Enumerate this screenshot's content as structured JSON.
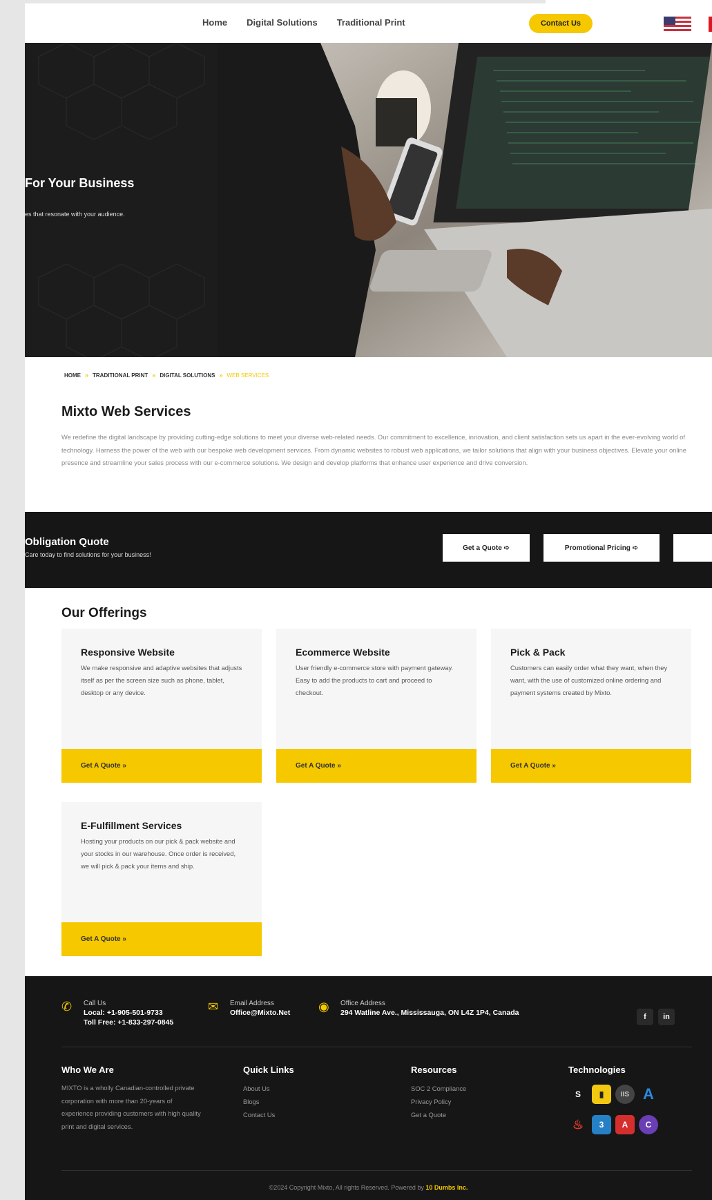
{
  "header": {
    "nav": [
      "Home",
      "Digital Solutions",
      "Traditional Print"
    ],
    "contact_button": "Contact Us"
  },
  "hero": {
    "title": "For Your Business",
    "subtitle": "es that resonate with your audience."
  },
  "breadcrumb": {
    "items": [
      "HOME",
      "TRADITIONAL PRINT",
      "DIGITAL SOLUTIONS"
    ],
    "current": "WEB SERVICES",
    "separator": "»"
  },
  "intro": {
    "title": "Mixto Web Services",
    "text": "We redefine the digital landscape by providing cutting-edge solutions to meet your diverse web-related needs. Our commitment to excellence, innovation, and client satisfaction sets us apart in the ever-evolving world of technology. Harness the power of the web with our bespoke web development services. From dynamic websites to robust web applications, we tailor solutions that align with your business objectives. Elevate your online presence and streamline your sales process with our e-commerce solutions. We design and develop platforms that enhance user experience and drive conversion."
  },
  "quote_band": {
    "title": "Obligation Quote",
    "subtitle": "Care today to find solutions for your business!",
    "buttons": [
      "Get a Quote ➪",
      "Promotional Pricing ➪"
    ]
  },
  "offerings": {
    "title": "Our Offerings",
    "cards": [
      {
        "title": "Responsive Website",
        "desc": "We make responsive and adaptive websites that adjusts itself as per the screen size such as phone, tablet, desktop or any device.",
        "button": "Get A Quote »"
      },
      {
        "title": "Ecommerce Website",
        "desc": "User friendly e-commerce store with payment gateway. Easy to add the products to cart and proceed to checkout.",
        "button": "Get A Quote »"
      },
      {
        "title": "Pick & Pack",
        "desc": "Customers can easily order what they want, when they want, with the use of customized online ordering and payment systems created by Mixto.",
        "button": "Get A Quote »"
      },
      {
        "title": "E-Fulfillment Services",
        "desc": "Hosting your products on our pick & pack website and your stocks in our warehouse. Once order is received, we will pick & pack your items and ship.",
        "button": "Get A Quote »"
      }
    ]
  },
  "footer": {
    "call": {
      "label": "Call Us",
      "local": "Local: +1-905-501-9733",
      "tollfree": "Toll Free: +1-833-297-0845"
    },
    "email": {
      "label": "Email Address",
      "value": "Office@Mixto.Net"
    },
    "office": {
      "label": "Office Address",
      "value": "294 Watline Ave., Mississauga, ON L4Z 1P4, Canada"
    },
    "who": {
      "title": "Who We Are",
      "text": "MIXTO is a wholly Canadian-controlled private corporation with more than 20-years of experience providing customers with high quality print and digital services."
    },
    "quick_links": {
      "title": "Quick Links",
      "items": [
        "About Us",
        "Blogs",
        "Contact Us"
      ]
    },
    "resources": {
      "title": "Resources",
      "items": [
        "SOC 2 Compliance",
        "Privacy Policy",
        "Get a Quote"
      ]
    },
    "technologies": {
      "title": "Technologies",
      "icons": [
        "jquery-icon",
        "power-bi-icon",
        "iis-icon",
        "azure-icon",
        "codeigniter-icon",
        "css3-icon",
        "angular-icon",
        "csharp-icon"
      ]
    },
    "copyright": "©2024 Copyright Mixto, All rights Reserved. Powered by",
    "powered_by": "10 Dumbs Inc."
  },
  "colors": {
    "accent": "#f5c800",
    "dark": "#161616"
  }
}
